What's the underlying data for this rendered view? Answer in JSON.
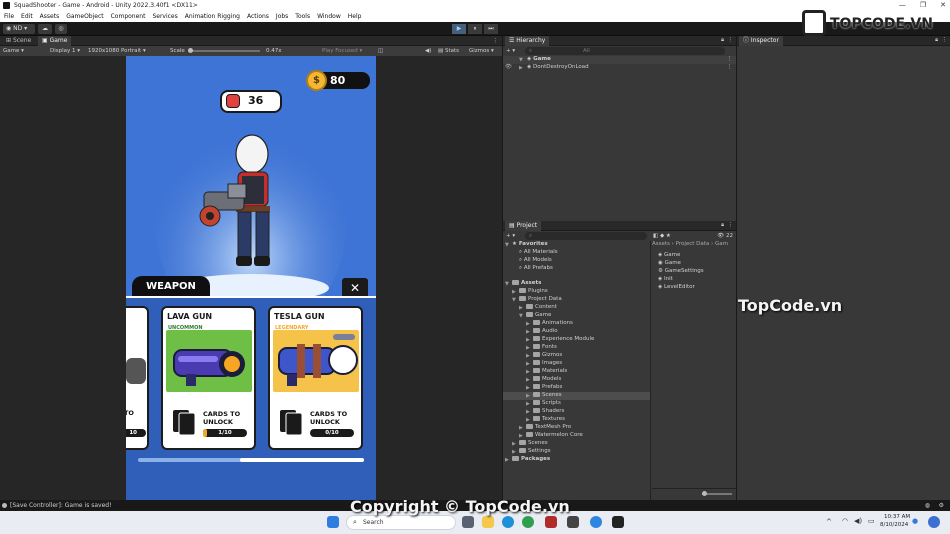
{
  "window": {
    "title": "SquadShooter - Game - Android - Unity 2022.3.40f1 <DX11>",
    "controls": [
      "—",
      "❐",
      "✕"
    ]
  },
  "menu": [
    "File",
    "Edit",
    "Assets",
    "GameObject",
    "Component",
    "Services",
    "Animation Rigging",
    "Actions",
    "Jobs",
    "Tools",
    "Window",
    "Help"
  ],
  "toolbar": {
    "account": "ND",
    "play": "▶",
    "pause": "⏸",
    "step": "⏭"
  },
  "game_panel": {
    "tabs": [
      "Scene",
      "Game"
    ],
    "active_tab": "Game",
    "view_mode": "Game",
    "display": "Display 1",
    "resolution": "1920x1080 Portrait",
    "scale_label": "Scale",
    "scale_value": "0.47x",
    "play_focused": "Play Focused",
    "stats": "Stats",
    "gizmos": "Gizmos"
  },
  "game": {
    "coins": "80",
    "coin_symbol": "$",
    "power": "36",
    "weapon_label": "WEAPON",
    "close_symbol": "✕",
    "cards": [
      {
        "name": "LAVA GUN",
        "rarity": "UNCOMMON",
        "rarity_color": "#2e7d32",
        "unlock": "CARDS TO UNLOCK",
        "progress": "1/10",
        "progress_fraction": 0.1
      },
      {
        "name": "TESLA GUN",
        "rarity": "LEGENDARY",
        "rarity_color": "#f5a623",
        "unlock": "CARDS TO UNLOCK",
        "progress": "0/10",
        "progress_fraction": 0.0
      }
    ],
    "partial_card": {
      "unlock_fragment": "TO",
      "progress_fragment": "10"
    }
  },
  "hierarchy": {
    "title": "Hierarchy",
    "search_placeholder": "All",
    "items": [
      "Game",
      "DontDestroyOnLoad"
    ]
  },
  "inspector": {
    "title": "Inspector"
  },
  "project": {
    "title": "Project",
    "breadcrumb": "Assets › Project Data › Gam",
    "badge": "22",
    "favorites_label": "Favorites",
    "favorites": [
      "All Materials",
      "All Models",
      "All Prefabs"
    ],
    "assets_label": "Assets",
    "tree": [
      {
        "label": "Plugins",
        "level": 1
      },
      {
        "label": "Project Data",
        "level": 1
      },
      {
        "label": "Content",
        "level": 2
      },
      {
        "label": "Game",
        "level": 2
      },
      {
        "label": "Animations",
        "level": 3
      },
      {
        "label": "Audio",
        "level": 3
      },
      {
        "label": "Experience Module",
        "level": 3
      },
      {
        "label": "Fonts",
        "level": 3
      },
      {
        "label": "Gizmos",
        "level": 3
      },
      {
        "label": "Images",
        "level": 3
      },
      {
        "label": "Materials",
        "level": 3
      },
      {
        "label": "Models",
        "level": 3
      },
      {
        "label": "Prefabs",
        "level": 3
      },
      {
        "label": "Scenes",
        "level": 3
      },
      {
        "label": "Scripts",
        "level": 3
      },
      {
        "label": "Shaders",
        "level": 3
      },
      {
        "label": "Textures",
        "level": 3
      },
      {
        "label": "TextMesh Pro",
        "level": 2
      },
      {
        "label": "Watermelon Core",
        "level": 2
      },
      {
        "label": "Scenes",
        "level": 1
      },
      {
        "label": "Settings",
        "level": 1
      }
    ],
    "packages_label": "Packages",
    "selected": "Scenes",
    "files": [
      "Game",
      "Game",
      "GameSettings",
      "Init",
      "LevelEditor"
    ]
  },
  "status": {
    "message": "[Save Controller]: Game is saved!"
  },
  "taskbar": {
    "search": "Search",
    "time": "10:37 AM",
    "date": "8/10/2024"
  },
  "watermark": {
    "logo": "TOPCODE.VN",
    "center": "TopCode.vn",
    "copyright": "Copyright © TopCode.vn"
  }
}
